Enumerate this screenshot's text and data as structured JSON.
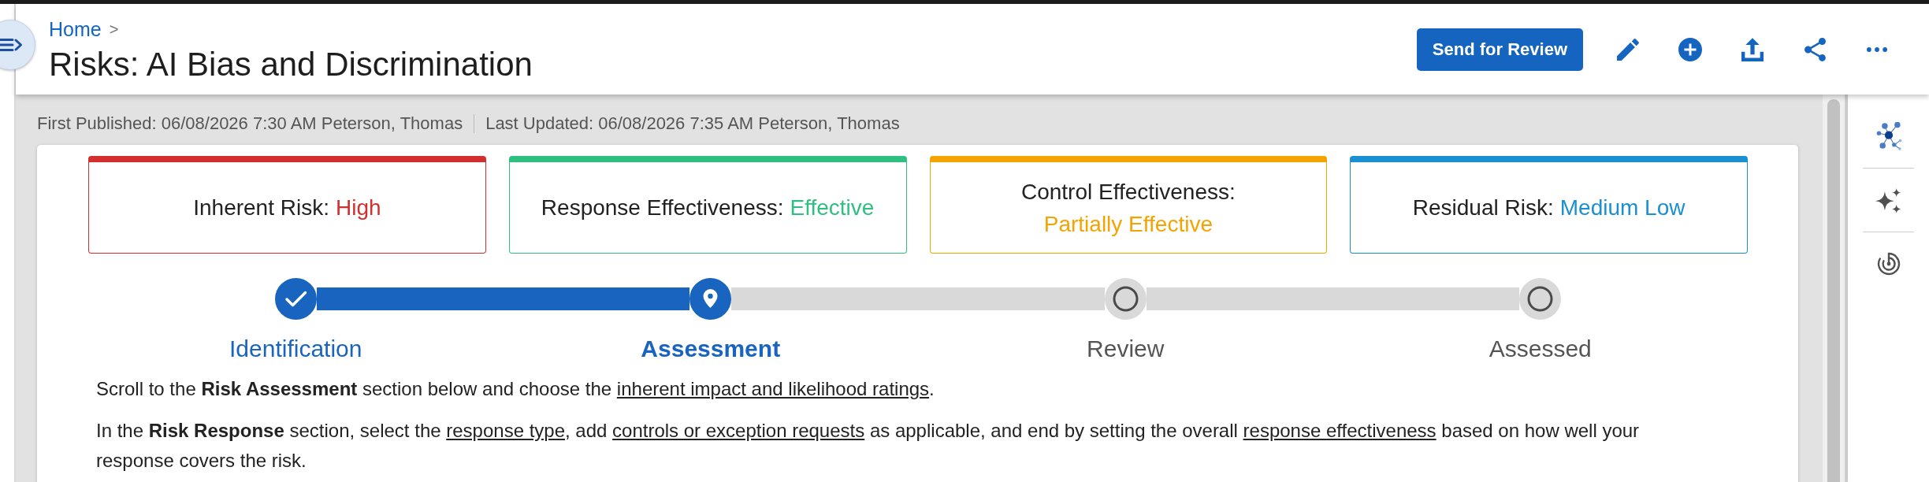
{
  "breadcrumb": {
    "items": [
      "Home"
    ],
    "separator": ">"
  },
  "title": "Risks: AI Bias and Discrimination",
  "primary_action": "Send for Review",
  "meta": [
    "First Published: 06/08/2026 7:30 AM Peterson, Thomas",
    "Last Updated: 06/08/2026 7:35 AM Peterson, Thomas"
  ],
  "status_cards": [
    {
      "label": "Inherent Risk:",
      "value": "High",
      "color": "#d32f2f"
    },
    {
      "label": "Response Effectiveness:",
      "value": "Effective",
      "color": "#2fbf80"
    },
    {
      "label": "Control Effectiveness:",
      "value": "Partially Effective",
      "color": "#f5a300"
    },
    {
      "label": "Residual Risk:",
      "value": "Medium Low",
      "color": "#1a8fd1"
    }
  ],
  "stepper": {
    "steps": [
      {
        "label": "Identification",
        "completed": true,
        "selected": false
      },
      {
        "label": "Assessment",
        "completed": false,
        "selected": true
      },
      {
        "label": "Review",
        "completed": false,
        "selected": false
      },
      {
        "label": "Assessed",
        "completed": false,
        "selected": false
      }
    ]
  },
  "instructions": [
    {
      "parts": [
        {
          "kind": "text",
          "text": "Scroll to the **Risk Assessment** section below and choose the "
        },
        {
          "kind": "link",
          "text": "inherent impact and likelihood ratings"
        },
        {
          "kind": "text",
          "text": "."
        }
      ]
    },
    {
      "parts": [
        {
          "kind": "text",
          "text": "In the **Risk Response** section, select the "
        },
        {
          "kind": "link",
          "text": "response type"
        },
        {
          "kind": "text",
          "text": ", add "
        },
        {
          "kind": "link",
          "text": "controls or exception requests"
        },
        {
          "kind": "text",
          "text": " as applicable, and end by setting the overall "
        },
        {
          "kind": "link",
          "text": "response effectiveness"
        },
        {
          "kind": "text",
          "text": " based on how well your response covers the risk."
        }
      ]
    }
  ]
}
